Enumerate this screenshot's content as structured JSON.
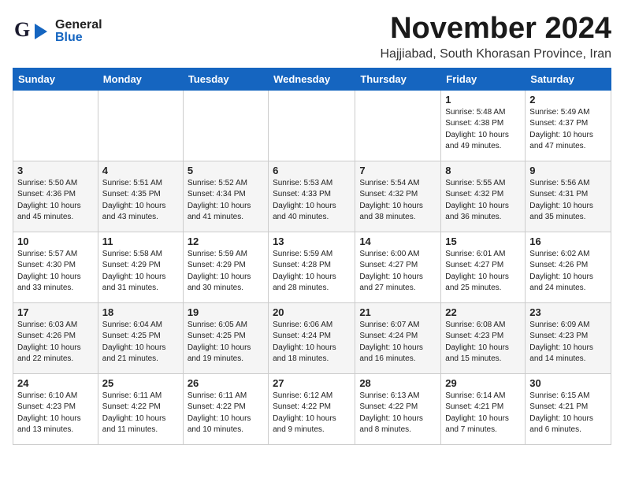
{
  "header": {
    "logo_general": "General",
    "logo_blue": "Blue",
    "month": "November 2024",
    "location": "Hajjiabad, South Khorasan Province, Iran"
  },
  "weekdays": [
    "Sunday",
    "Monday",
    "Tuesday",
    "Wednesday",
    "Thursday",
    "Friday",
    "Saturday"
  ],
  "weeks": [
    [
      {
        "day": "",
        "info": ""
      },
      {
        "day": "",
        "info": ""
      },
      {
        "day": "",
        "info": ""
      },
      {
        "day": "",
        "info": ""
      },
      {
        "day": "",
        "info": ""
      },
      {
        "day": "1",
        "info": "Sunrise: 5:48 AM\nSunset: 4:38 PM\nDaylight: 10 hours\nand 49 minutes."
      },
      {
        "day": "2",
        "info": "Sunrise: 5:49 AM\nSunset: 4:37 PM\nDaylight: 10 hours\nand 47 minutes."
      }
    ],
    [
      {
        "day": "3",
        "info": "Sunrise: 5:50 AM\nSunset: 4:36 PM\nDaylight: 10 hours\nand 45 minutes."
      },
      {
        "day": "4",
        "info": "Sunrise: 5:51 AM\nSunset: 4:35 PM\nDaylight: 10 hours\nand 43 minutes."
      },
      {
        "day": "5",
        "info": "Sunrise: 5:52 AM\nSunset: 4:34 PM\nDaylight: 10 hours\nand 41 minutes."
      },
      {
        "day": "6",
        "info": "Sunrise: 5:53 AM\nSunset: 4:33 PM\nDaylight: 10 hours\nand 40 minutes."
      },
      {
        "day": "7",
        "info": "Sunrise: 5:54 AM\nSunset: 4:32 PM\nDaylight: 10 hours\nand 38 minutes."
      },
      {
        "day": "8",
        "info": "Sunrise: 5:55 AM\nSunset: 4:32 PM\nDaylight: 10 hours\nand 36 minutes."
      },
      {
        "day": "9",
        "info": "Sunrise: 5:56 AM\nSunset: 4:31 PM\nDaylight: 10 hours\nand 35 minutes."
      }
    ],
    [
      {
        "day": "10",
        "info": "Sunrise: 5:57 AM\nSunset: 4:30 PM\nDaylight: 10 hours\nand 33 minutes."
      },
      {
        "day": "11",
        "info": "Sunrise: 5:58 AM\nSunset: 4:29 PM\nDaylight: 10 hours\nand 31 minutes."
      },
      {
        "day": "12",
        "info": "Sunrise: 5:59 AM\nSunset: 4:29 PM\nDaylight: 10 hours\nand 30 minutes."
      },
      {
        "day": "13",
        "info": "Sunrise: 5:59 AM\nSunset: 4:28 PM\nDaylight: 10 hours\nand 28 minutes."
      },
      {
        "day": "14",
        "info": "Sunrise: 6:00 AM\nSunset: 4:27 PM\nDaylight: 10 hours\nand 27 minutes."
      },
      {
        "day": "15",
        "info": "Sunrise: 6:01 AM\nSunset: 4:27 PM\nDaylight: 10 hours\nand 25 minutes."
      },
      {
        "day": "16",
        "info": "Sunrise: 6:02 AM\nSunset: 4:26 PM\nDaylight: 10 hours\nand 24 minutes."
      }
    ],
    [
      {
        "day": "17",
        "info": "Sunrise: 6:03 AM\nSunset: 4:26 PM\nDaylight: 10 hours\nand 22 minutes."
      },
      {
        "day": "18",
        "info": "Sunrise: 6:04 AM\nSunset: 4:25 PM\nDaylight: 10 hours\nand 21 minutes."
      },
      {
        "day": "19",
        "info": "Sunrise: 6:05 AM\nSunset: 4:25 PM\nDaylight: 10 hours\nand 19 minutes."
      },
      {
        "day": "20",
        "info": "Sunrise: 6:06 AM\nSunset: 4:24 PM\nDaylight: 10 hours\nand 18 minutes."
      },
      {
        "day": "21",
        "info": "Sunrise: 6:07 AM\nSunset: 4:24 PM\nDaylight: 10 hours\nand 16 minutes."
      },
      {
        "day": "22",
        "info": "Sunrise: 6:08 AM\nSunset: 4:23 PM\nDaylight: 10 hours\nand 15 minutes."
      },
      {
        "day": "23",
        "info": "Sunrise: 6:09 AM\nSunset: 4:23 PM\nDaylight: 10 hours\nand 14 minutes."
      }
    ],
    [
      {
        "day": "24",
        "info": "Sunrise: 6:10 AM\nSunset: 4:23 PM\nDaylight: 10 hours\nand 13 minutes."
      },
      {
        "day": "25",
        "info": "Sunrise: 6:11 AM\nSunset: 4:22 PM\nDaylight: 10 hours\nand 11 minutes."
      },
      {
        "day": "26",
        "info": "Sunrise: 6:11 AM\nSunset: 4:22 PM\nDaylight: 10 hours\nand 10 minutes."
      },
      {
        "day": "27",
        "info": "Sunrise: 6:12 AM\nSunset: 4:22 PM\nDaylight: 10 hours\nand 9 minutes."
      },
      {
        "day": "28",
        "info": "Sunrise: 6:13 AM\nSunset: 4:22 PM\nDaylight: 10 hours\nand 8 minutes."
      },
      {
        "day": "29",
        "info": "Sunrise: 6:14 AM\nSunset: 4:21 PM\nDaylight: 10 hours\nand 7 minutes."
      },
      {
        "day": "30",
        "info": "Sunrise: 6:15 AM\nSunset: 4:21 PM\nDaylight: 10 hours\nand 6 minutes."
      }
    ]
  ]
}
